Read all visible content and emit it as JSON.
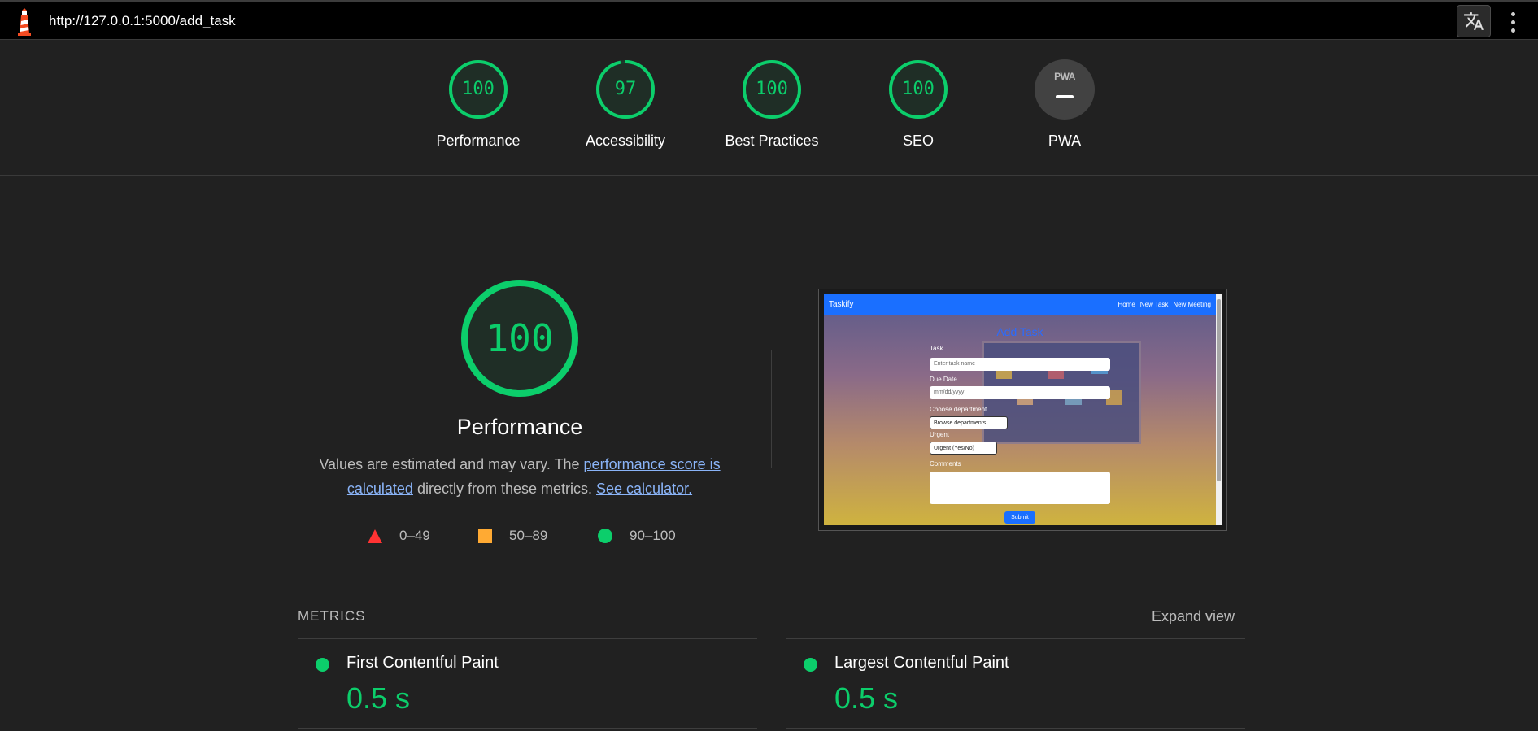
{
  "topbar": {
    "url": "http://127.0.0.1:5000/add_task",
    "logo_icon": "lighthouse-icon",
    "translate_icon": "translate-icon",
    "menu_icon": "more-vert-icon"
  },
  "categories": [
    {
      "score": "100",
      "label": "Performance",
      "value": 100
    },
    {
      "score": "97",
      "label": "Accessibility",
      "value": 97
    },
    {
      "score": "100",
      "label": "Best Practices",
      "value": 100
    },
    {
      "score": "100",
      "label": "SEO",
      "value": 100
    },
    {
      "score": "",
      "label": "PWA",
      "badge_text": "PWA"
    }
  ],
  "performance": {
    "score": "100",
    "score_value": 100,
    "title": "Performance",
    "desc_prefix": "Values are estimated and may vary. The ",
    "desc_link1": "performance score is calculated",
    "desc_middle": " directly from these metrics. ",
    "desc_link2": "See calculator.",
    "legend": [
      {
        "range": "0–49",
        "shape": "triangle",
        "color": "#ff3333"
      },
      {
        "range": "50–89",
        "shape": "square",
        "color": "#ffaa33"
      },
      {
        "range": "90–100",
        "shape": "circle",
        "color": "#0cce6b"
      }
    ]
  },
  "preview": {
    "brand": "Taskify",
    "nav_links": [
      "Home",
      "New Task",
      "New Meeting"
    ],
    "title": "Add Task",
    "task_label": "Task",
    "task_placeholder": "Enter task name",
    "due_label": "Due Date",
    "due_placeholder": "mm/dd/yyyy",
    "dept_label": "Choose department",
    "dept_select": "Browse departments",
    "urgent_label": "Urgent",
    "urgent_select": "Urgent (Yes/No)",
    "comments_label": "Comments",
    "submit": "Submit"
  },
  "metrics": {
    "heading": "METRICS",
    "expand": "Expand view",
    "items": [
      {
        "title": "First Contentful Paint",
        "value": "0.5 s"
      },
      {
        "title": "Largest Contentful Paint",
        "value": "0.5 s"
      }
    ]
  },
  "colors": {
    "pass": "#0cce6b",
    "average": "#ffaa33",
    "fail": "#ff3333",
    "link": "#8ab4f8"
  }
}
